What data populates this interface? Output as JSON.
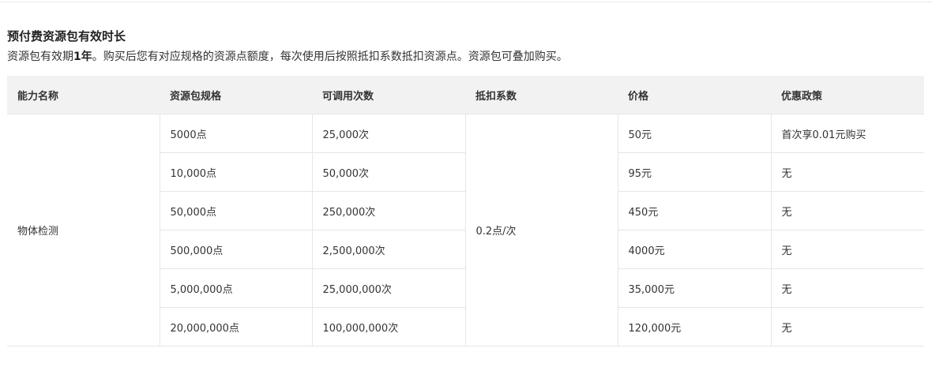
{
  "heading": {
    "title": "预付费资源包有效时长",
    "desc_prefix": "资源包有效期",
    "desc_bold": "1年",
    "desc_suffix": "。购买后您有对应规格的资源点额度，每次使用后按照抵扣系数抵扣资源点。资源包可叠加购买。"
  },
  "table": {
    "headers": [
      "能力名称",
      "资源包规格",
      "可调用次数",
      "抵扣系数",
      "价格",
      "优惠政策"
    ],
    "capability": "物体检测",
    "deduction": "0.2点/次",
    "rows": [
      {
        "spec": "5000点",
        "calls": "25,000次",
        "price": "50元",
        "promo": "首次享0.01元购买"
      },
      {
        "spec": "10,000点",
        "calls": "50,000次",
        "price": "95元",
        "promo": "无"
      },
      {
        "spec": "50,000点",
        "calls": "250,000次",
        "price": "450元",
        "promo": "无"
      },
      {
        "spec": "500,000点",
        "calls": "2,500,000次",
        "price": "4000元",
        "promo": "无"
      },
      {
        "spec": "5,000,000点",
        "calls": "25,000,000次",
        "price": "35,000元",
        "promo": "无"
      },
      {
        "spec": "20,000,000点",
        "calls": "100,000,000次",
        "price": "120,000元",
        "promo": "无"
      }
    ]
  }
}
